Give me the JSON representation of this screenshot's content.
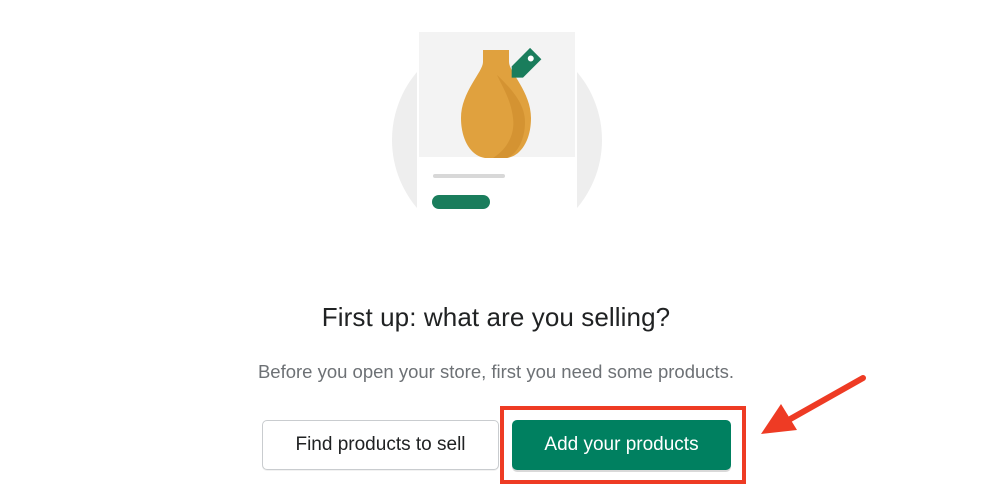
{
  "heading": "First up: what are you selling?",
  "subtext": "Before you open your store, first you need some products.",
  "buttons": {
    "secondary_label": "Find products to sell",
    "primary_label": "Add your products"
  },
  "colors": {
    "primary": "#008060",
    "annotation": "#ee3b24",
    "vase": "#e0a13e",
    "tag": "#1a7d5c"
  },
  "icons": {
    "illustration": "vase-product-card-illustration",
    "annotation": "red-arrow-annotation"
  }
}
